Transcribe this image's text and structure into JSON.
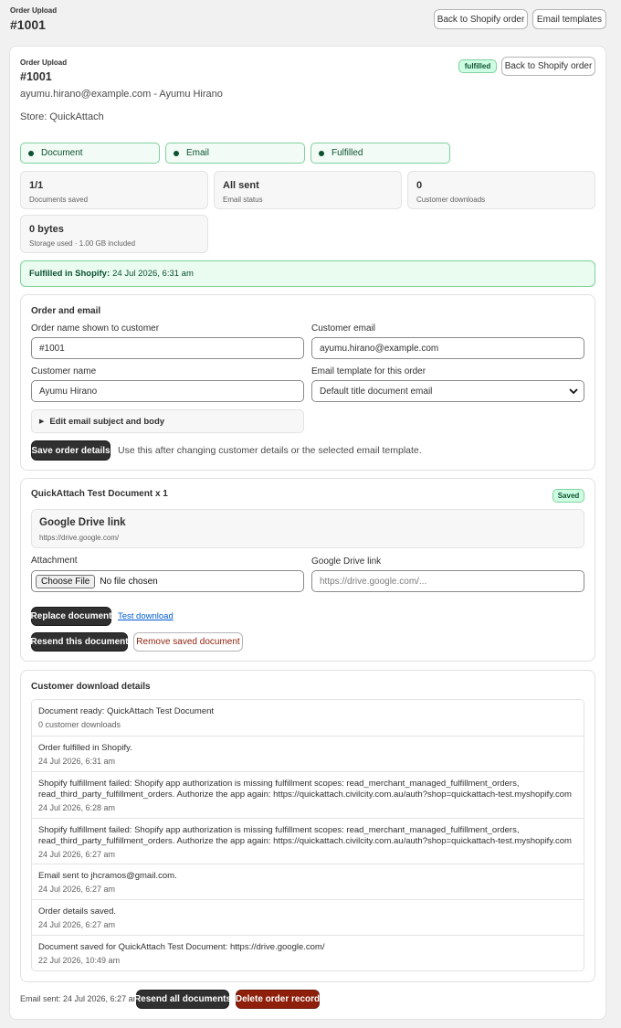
{
  "header": {
    "section_label": "Order Upload",
    "order_title": "#1001",
    "back_button": "Back to Shopify order",
    "templates_button": "Email templates"
  },
  "card": {
    "section_label": "Order Upload",
    "order_title": "#1001",
    "status_badge": "fulfilled",
    "back_button": "Back to Shopify order",
    "customer_line": "ayumu.hirano@example.com - Ayumu Hirano",
    "store_line": "Store: QuickAttach"
  },
  "status_pills": [
    {
      "label": "Document"
    },
    {
      "label": "Email"
    },
    {
      "label": "Fulfilled"
    }
  ],
  "stats": [
    {
      "value": "1/1",
      "label": "Documents saved"
    },
    {
      "value": "All sent",
      "label": "Email status"
    },
    {
      "value": "0",
      "label": "Customer downloads"
    },
    {
      "value": "0 bytes",
      "label": "Storage used · 1.00 GB included"
    }
  ],
  "fulfilled_banner": {
    "label": "Fulfilled in Shopify:",
    "date": "24 Jul 2026, 6:31 am"
  },
  "order_form": {
    "title": "Order and email",
    "order_name_label": "Order name shown to customer",
    "order_name_value": "#1001",
    "customer_email_label": "Customer email",
    "customer_email_value": "ayumu.hirano@example.com",
    "customer_name_label": "Customer name",
    "customer_name_value": "Ayumu Hirano",
    "template_label": "Email template for this order",
    "template_value": "Default title document email",
    "edit_toggle": "Edit email subject and body",
    "save_button": "Save order details",
    "save_hint": "Use this after changing customer details or the selected email template."
  },
  "document": {
    "title": "QuickAttach Test Document x 1",
    "status_badge": "Saved",
    "link_title": "Google Drive link",
    "link_url": "https://drive.google.com/",
    "attachment_label": "Attachment",
    "choose_file_button": "Choose File",
    "no_file_text": "No file chosen",
    "drive_label": "Google Drive link",
    "drive_placeholder": "https://drive.google.com/...",
    "replace_button": "Replace document",
    "test_download_link": "Test download",
    "resend_button": "Resend this document",
    "remove_button": "Remove saved document"
  },
  "downloads": {
    "title": "Customer download details",
    "items": [
      {
        "message": "Document ready: QuickAttach Test Document",
        "date": "0 customer downloads"
      },
      {
        "message": "Order fulfilled in Shopify.",
        "date": "24 Jul 2026, 6:31 am"
      },
      {
        "message": "Shopify fulfillment failed: Shopify app authorization is missing fulfillment scopes: read_merchant_managed_fulfillment_orders, read_third_party_fulfillment_orders. Authorize the app again: https://quickattach.civilcity.com.au/auth?shop=quickattach-test.myshopify.com",
        "date": "24 Jul 2026, 6:28 am"
      },
      {
        "message": "Shopify fulfillment failed: Shopify app authorization is missing fulfillment scopes: read_merchant_managed_fulfillment_orders, read_third_party_fulfillment_orders. Authorize the app again: https://quickattach.civilcity.com.au/auth?shop=quickattach-test.myshopify.com",
        "date": "24 Jul 2026, 6:27 am"
      },
      {
        "message": "Email sent to jhcramos@gmail.com.",
        "date": "24 Jul 2026, 6:27 am"
      },
      {
        "message": "Order details saved.",
        "date": "24 Jul 2026, 6:27 am"
      },
      {
        "message": "Document saved for QuickAttach Test Document: https://drive.google.com/",
        "date": "22 Jul 2026, 10:49 am"
      }
    ]
  },
  "footer": {
    "email_sent": "Email sent: 24 Jul 2026, 6:27 am",
    "resend_all_button": "Resend all documents",
    "delete_button": "Delete order record"
  },
  "colors": {
    "primary_dark": "#303030",
    "success_green": "#0c5132",
    "success_bg": "#cdfee1",
    "danger_red": "#8e1f0b",
    "link_blue": "#005bd3"
  }
}
